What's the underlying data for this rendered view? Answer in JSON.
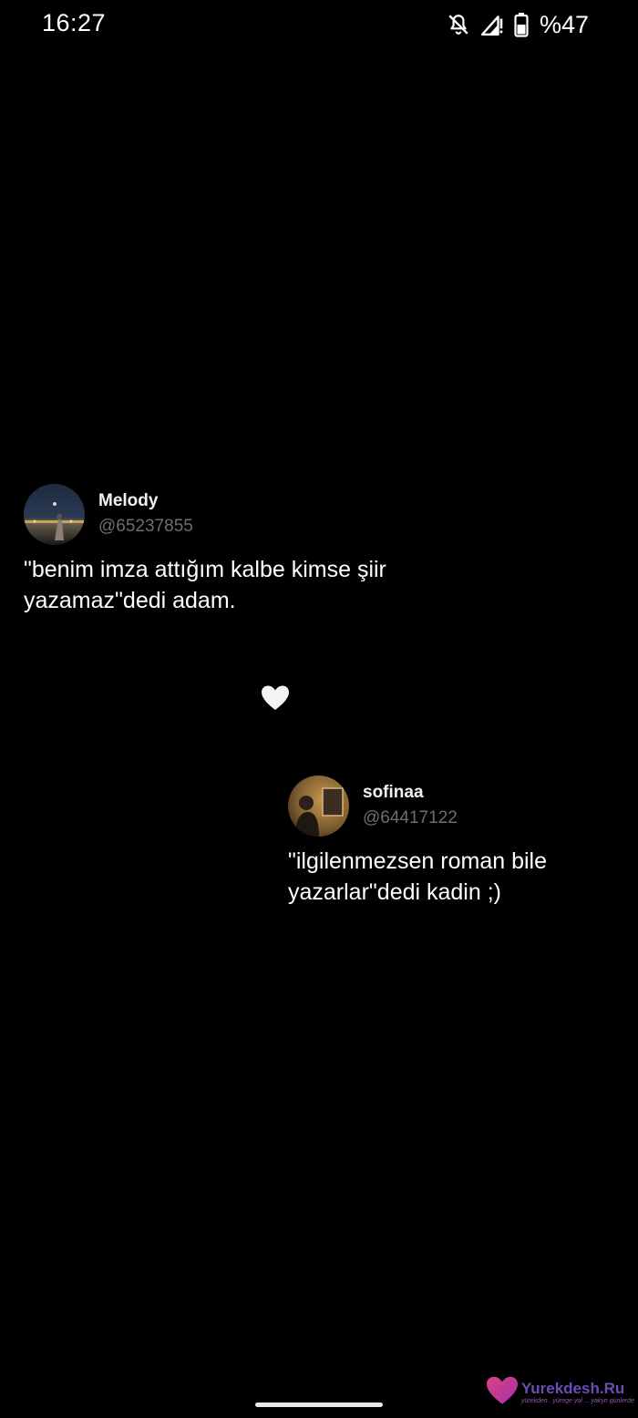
{
  "status_bar": {
    "time": "16:27",
    "battery": "%47",
    "icons": [
      "notifications-off-icon",
      "signal-no-data-icon",
      "battery-icon"
    ]
  },
  "posts": [
    {
      "username": "Melody",
      "handle": "@65237855",
      "text": "\"benim imza attığım kalbe kimse şiir\nyazamaz\"dedi adam."
    },
    {
      "username": "sofinaa",
      "handle": "@64417122",
      "text": "\"ilgilenmezsen roman bile\nyazarlar\"dedi kadin ;)"
    }
  ],
  "divider_emoji": "white-heart-icon",
  "watermark": {
    "brand": "Yurekdesh.Ru",
    "tagline": "yürekden.. yürege yol ... yakyn günlerde"
  },
  "colors": {
    "background": "#000000",
    "text": "#ffffff",
    "handle": "#6e6e6e",
    "watermark": "#7f5bd6"
  }
}
